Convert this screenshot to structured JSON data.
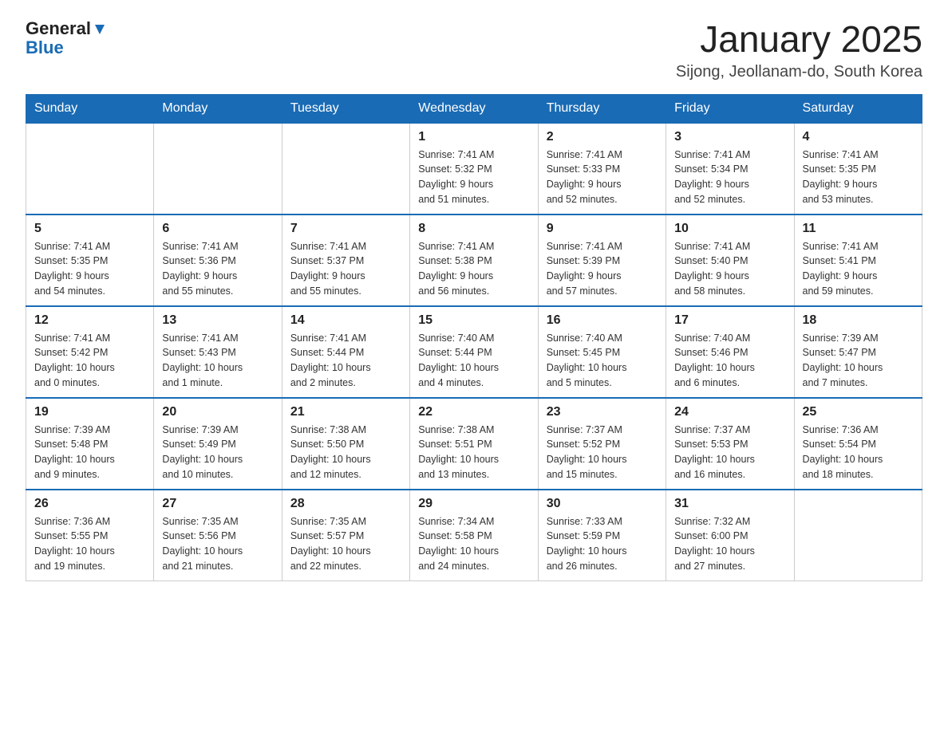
{
  "logo": {
    "general": "General",
    "blue": "Blue"
  },
  "header": {
    "title": "January 2025",
    "subtitle": "Sijong, Jeollanam-do, South Korea"
  },
  "weekdays": [
    "Sunday",
    "Monday",
    "Tuesday",
    "Wednesday",
    "Thursday",
    "Friday",
    "Saturday"
  ],
  "weeks": [
    [
      {
        "day": "",
        "info": ""
      },
      {
        "day": "",
        "info": ""
      },
      {
        "day": "",
        "info": ""
      },
      {
        "day": "1",
        "info": "Sunrise: 7:41 AM\nSunset: 5:32 PM\nDaylight: 9 hours\nand 51 minutes."
      },
      {
        "day": "2",
        "info": "Sunrise: 7:41 AM\nSunset: 5:33 PM\nDaylight: 9 hours\nand 52 minutes."
      },
      {
        "day": "3",
        "info": "Sunrise: 7:41 AM\nSunset: 5:34 PM\nDaylight: 9 hours\nand 52 minutes."
      },
      {
        "day": "4",
        "info": "Sunrise: 7:41 AM\nSunset: 5:35 PM\nDaylight: 9 hours\nand 53 minutes."
      }
    ],
    [
      {
        "day": "5",
        "info": "Sunrise: 7:41 AM\nSunset: 5:35 PM\nDaylight: 9 hours\nand 54 minutes."
      },
      {
        "day": "6",
        "info": "Sunrise: 7:41 AM\nSunset: 5:36 PM\nDaylight: 9 hours\nand 55 minutes."
      },
      {
        "day": "7",
        "info": "Sunrise: 7:41 AM\nSunset: 5:37 PM\nDaylight: 9 hours\nand 55 minutes."
      },
      {
        "day": "8",
        "info": "Sunrise: 7:41 AM\nSunset: 5:38 PM\nDaylight: 9 hours\nand 56 minutes."
      },
      {
        "day": "9",
        "info": "Sunrise: 7:41 AM\nSunset: 5:39 PM\nDaylight: 9 hours\nand 57 minutes."
      },
      {
        "day": "10",
        "info": "Sunrise: 7:41 AM\nSunset: 5:40 PM\nDaylight: 9 hours\nand 58 minutes."
      },
      {
        "day": "11",
        "info": "Sunrise: 7:41 AM\nSunset: 5:41 PM\nDaylight: 9 hours\nand 59 minutes."
      }
    ],
    [
      {
        "day": "12",
        "info": "Sunrise: 7:41 AM\nSunset: 5:42 PM\nDaylight: 10 hours\nand 0 minutes."
      },
      {
        "day": "13",
        "info": "Sunrise: 7:41 AM\nSunset: 5:43 PM\nDaylight: 10 hours\nand 1 minute."
      },
      {
        "day": "14",
        "info": "Sunrise: 7:41 AM\nSunset: 5:44 PM\nDaylight: 10 hours\nand 2 minutes."
      },
      {
        "day": "15",
        "info": "Sunrise: 7:40 AM\nSunset: 5:44 PM\nDaylight: 10 hours\nand 4 minutes."
      },
      {
        "day": "16",
        "info": "Sunrise: 7:40 AM\nSunset: 5:45 PM\nDaylight: 10 hours\nand 5 minutes."
      },
      {
        "day": "17",
        "info": "Sunrise: 7:40 AM\nSunset: 5:46 PM\nDaylight: 10 hours\nand 6 minutes."
      },
      {
        "day": "18",
        "info": "Sunrise: 7:39 AM\nSunset: 5:47 PM\nDaylight: 10 hours\nand 7 minutes."
      }
    ],
    [
      {
        "day": "19",
        "info": "Sunrise: 7:39 AM\nSunset: 5:48 PM\nDaylight: 10 hours\nand 9 minutes."
      },
      {
        "day": "20",
        "info": "Sunrise: 7:39 AM\nSunset: 5:49 PM\nDaylight: 10 hours\nand 10 minutes."
      },
      {
        "day": "21",
        "info": "Sunrise: 7:38 AM\nSunset: 5:50 PM\nDaylight: 10 hours\nand 12 minutes."
      },
      {
        "day": "22",
        "info": "Sunrise: 7:38 AM\nSunset: 5:51 PM\nDaylight: 10 hours\nand 13 minutes."
      },
      {
        "day": "23",
        "info": "Sunrise: 7:37 AM\nSunset: 5:52 PM\nDaylight: 10 hours\nand 15 minutes."
      },
      {
        "day": "24",
        "info": "Sunrise: 7:37 AM\nSunset: 5:53 PM\nDaylight: 10 hours\nand 16 minutes."
      },
      {
        "day": "25",
        "info": "Sunrise: 7:36 AM\nSunset: 5:54 PM\nDaylight: 10 hours\nand 18 minutes."
      }
    ],
    [
      {
        "day": "26",
        "info": "Sunrise: 7:36 AM\nSunset: 5:55 PM\nDaylight: 10 hours\nand 19 minutes."
      },
      {
        "day": "27",
        "info": "Sunrise: 7:35 AM\nSunset: 5:56 PM\nDaylight: 10 hours\nand 21 minutes."
      },
      {
        "day": "28",
        "info": "Sunrise: 7:35 AM\nSunset: 5:57 PM\nDaylight: 10 hours\nand 22 minutes."
      },
      {
        "day": "29",
        "info": "Sunrise: 7:34 AM\nSunset: 5:58 PM\nDaylight: 10 hours\nand 24 minutes."
      },
      {
        "day": "30",
        "info": "Sunrise: 7:33 AM\nSunset: 5:59 PM\nDaylight: 10 hours\nand 26 minutes."
      },
      {
        "day": "31",
        "info": "Sunrise: 7:32 AM\nSunset: 6:00 PM\nDaylight: 10 hours\nand 27 minutes."
      },
      {
        "day": "",
        "info": ""
      }
    ]
  ]
}
